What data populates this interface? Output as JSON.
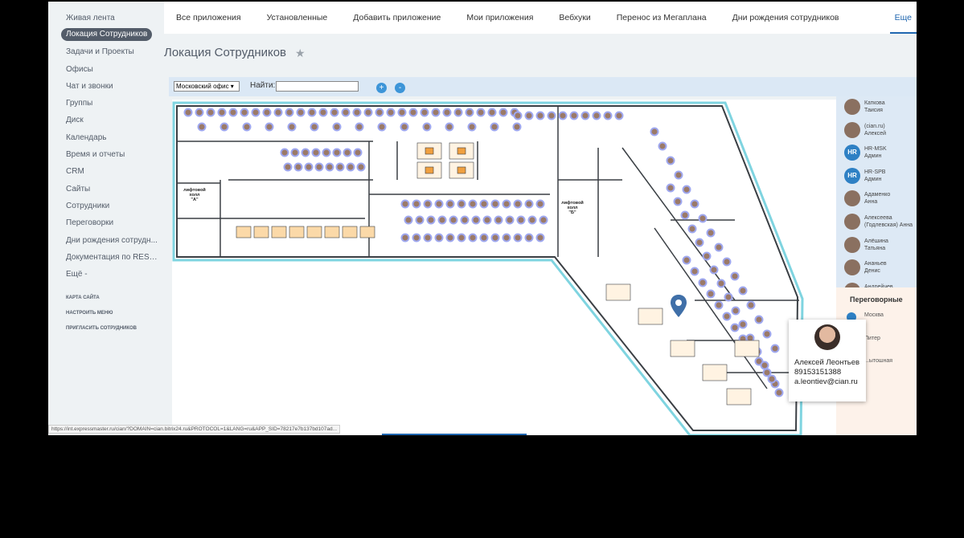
{
  "sidebar": {
    "items": [
      {
        "label": "Живая лента"
      },
      {
        "label": "Локация Сотрудников",
        "active": true
      },
      {
        "label": "Задачи и Проекты"
      },
      {
        "label": "Офисы"
      },
      {
        "label": "Чат и звонки"
      },
      {
        "label": "Группы"
      },
      {
        "label": "Диск"
      },
      {
        "label": "Календарь"
      },
      {
        "label": "Время и отчеты"
      },
      {
        "label": "CRM"
      },
      {
        "label": "Сайты"
      },
      {
        "label": "Сотрудники"
      },
      {
        "label": "Переговорки"
      },
      {
        "label": "Дни рождения сотрудн..."
      },
      {
        "label": "Документация по REST ..."
      },
      {
        "label": "Ещё -"
      }
    ],
    "footer": [
      "КАРТА САЙТА",
      "НАСТРОИТЬ МЕНЮ",
      "ПРИГЛАСИТЬ СОТРУДНИКОВ"
    ]
  },
  "topnav": {
    "items": [
      "Все приложения",
      "Установленные",
      "Добавить приложение",
      "Мои приложения",
      "Вебхуки",
      "Перенос из Мегаплана",
      "Дни рождения сотрудников"
    ],
    "more": "Еще"
  },
  "page": {
    "title": "Локация Сотрудников"
  },
  "toolbar": {
    "office_select": "Московский офис ▾",
    "find_label": "Найти:",
    "zoom_in": "+",
    "zoom_out": "-"
  },
  "map": {
    "elevator_hall_a": [
      "лифтовой",
      "холл",
      "\"А\""
    ],
    "elevator_hall_b": [
      "лифтовой",
      "холл",
      "\"Б\""
    ]
  },
  "people_panel": {
    "people": [
      {
        "name": "Каткова",
        "sub": "Таисия",
        "hr": false
      },
      {
        "name": "(cian.ru)",
        "sub": "Алексей",
        "hr": false
      },
      {
        "name": "HR-MSK",
        "sub": "Админ",
        "hr": true
      },
      {
        "name": "HR-SPB",
        "sub": "Админ",
        "hr": true
      },
      {
        "name": "Адаменко",
        "sub": "Анна",
        "hr": false
      },
      {
        "name": "Алексеева",
        "sub": "(Годлевская) Анна",
        "hr": false
      },
      {
        "name": "Алёшина",
        "sub": "Татьяна",
        "hr": false
      },
      {
        "name": "Ананьев",
        "sub": "Денис",
        "hr": false
      },
      {
        "name": "Андрейчев",
        "sub": "",
        "hr": false
      }
    ],
    "hr_badge": "HR"
  },
  "rooms_panel": {
    "title": "Переговорные",
    "rooms": [
      "Москва",
      "Питер",
      "...ытошная"
    ]
  },
  "popup": {
    "name": "Алексей Леонтьев",
    "phone": "89153151388",
    "email": "a.leontiev@cian.ru"
  },
  "statusbar": {
    "url": "https://int.expressmaster.ru/cian/?DOMAIN=cian.bitrix24.ru&PROTOCOL=1&LANG=ru&APP_SID=78217e7b137bd107ad..."
  },
  "colors": {
    "accent": "#2067b0",
    "sidebar_active": "#535c69",
    "map_walls": "#3a3f44",
    "map_outline": "#7fd4e0",
    "desk": "#f0a040"
  }
}
